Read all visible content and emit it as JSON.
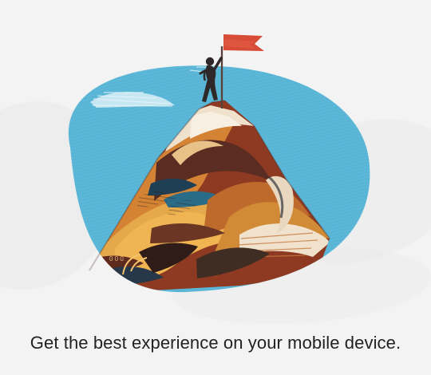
{
  "screen": {
    "message": "Get the best experience on your mobile device."
  },
  "illustration": {
    "sky_color": "#5bb8d8",
    "flag_color": "#d84b36",
    "mountain_colors": [
      "#c97932",
      "#e7a448",
      "#6e2b1c",
      "#263e55",
      "#f0e1c8"
    ]
  }
}
